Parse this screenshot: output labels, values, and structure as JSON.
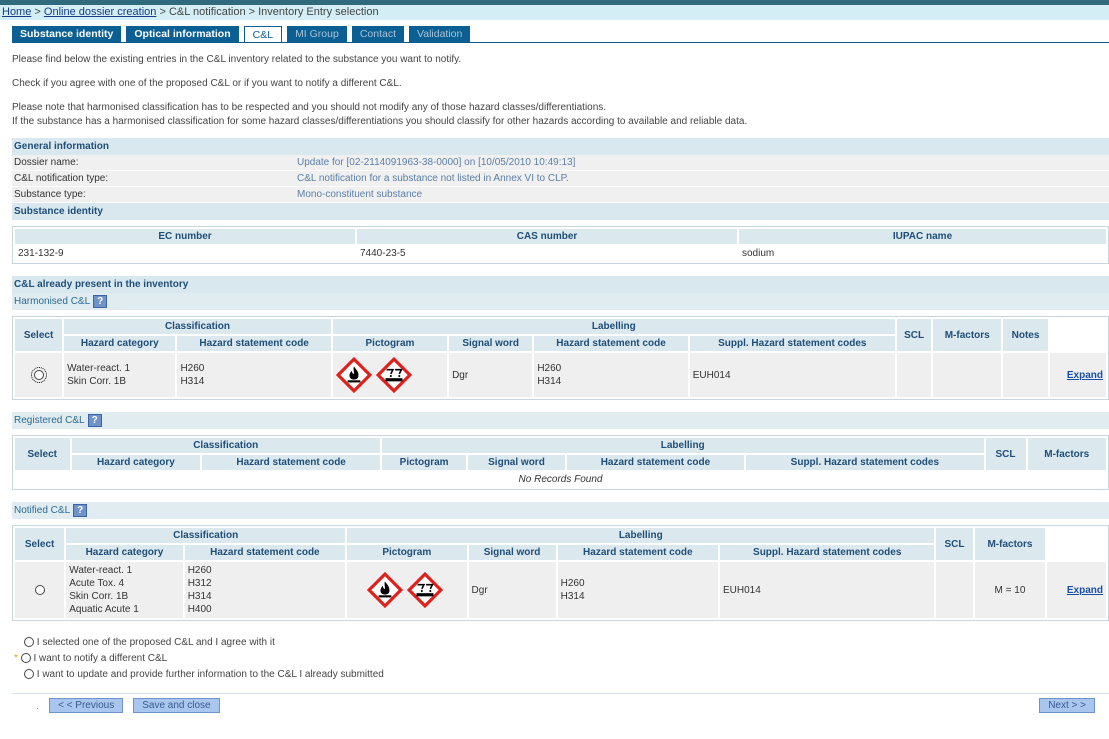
{
  "breadcrumb": {
    "home": "Home",
    "online": "Online dossier creation",
    "rest": "> C&L notification > Inventory Entry selection"
  },
  "tabs": [
    {
      "label": "Substance identity"
    },
    {
      "label": "Optical information"
    },
    {
      "label": "C&L"
    },
    {
      "label": "MI Group"
    },
    {
      "label": "Contact"
    },
    {
      "label": "Validation"
    }
  ],
  "intro": [
    "Please find below the existing entries in the C&L inventory related to the substance you want to notify.",
    "Check if you agree with one of the proposed C&L or if you want to notify a different C&L.",
    "Please note that harmonised classification has to be respected and you should not modify any of those hazard classes/differentiations.",
    "If the substance has a harmonised classification for some hazard classes/differentiations you should classify for other hazards according to available and reliable data."
  ],
  "general": {
    "title": "General information",
    "rows": [
      {
        "k": "Dossier name:",
        "v": "Update for [02-2114091963-38-0000] on [10/05/2010 10:49:13]"
      },
      {
        "k": "C&L notification type:",
        "v": "C&L notification for a substance not listed in Annex VI to CLP."
      },
      {
        "k": "Substance type:",
        "v": "Mono-constituent substance"
      }
    ]
  },
  "identity": {
    "title": "Substance identity",
    "headers": [
      "EC number",
      "CAS number",
      "IUPAC name"
    ],
    "values": [
      "231-132-9",
      "7440-23-5",
      "sodium"
    ]
  },
  "inventory_title": "C&L already present in the inventory",
  "help": "?",
  "h": {
    "select": "Select",
    "classification": "Classification",
    "labelling": "Labelling",
    "hazard_category": "Hazard category",
    "hsc": "Hazard statement code",
    "pictogram": "Pictogram",
    "signal": "Signal word",
    "suppl": "Suppl. Hazard statement codes",
    "scl": "SCL",
    "mf": "M-factors",
    "notes": "Notes",
    "expand": "Expand"
  },
  "harmonised": {
    "title": "Harmonised C&L",
    "cat": "Water-react. 1\nSkin Corr. 1B",
    "hsc": "H260\nH314",
    "signal": "Dgr",
    "lhsc": "H260\nH314",
    "suppl": "EUH014",
    "pictograms": [
      "flame-pictogram",
      "corrosion-pictogram"
    ]
  },
  "registered": {
    "title": "Registered C&L",
    "empty": "No Records Found"
  },
  "notified": {
    "title": "Notified C&L",
    "cat": "Water-react. 1\nAcute Tox. 4\nSkin Corr. 1B\nAquatic Acute 1",
    "hsc": "H260\nH312\nH314\nH400",
    "signal": "Dgr",
    "lhsc": "H260\nH314",
    "suppl": "EUH014",
    "mf": "M = 10",
    "pictograms": [
      "flame-pictogram",
      "corrosion-pictogram"
    ]
  },
  "options": [
    "I selected one of the proposed C&L and I agree with it",
    "I want to notify a different C&L",
    "I want to update and provide further information to the C&L I already submitted"
  ],
  "required_mark": "*",
  "buttons": {
    "prev": "< < Previous",
    "save": "Save and close",
    "next": "Next > >"
  },
  "colors": {
    "tab": "#0b5f93",
    "section": "#d9e8ee",
    "pictogram_border": "#e0201b"
  }
}
